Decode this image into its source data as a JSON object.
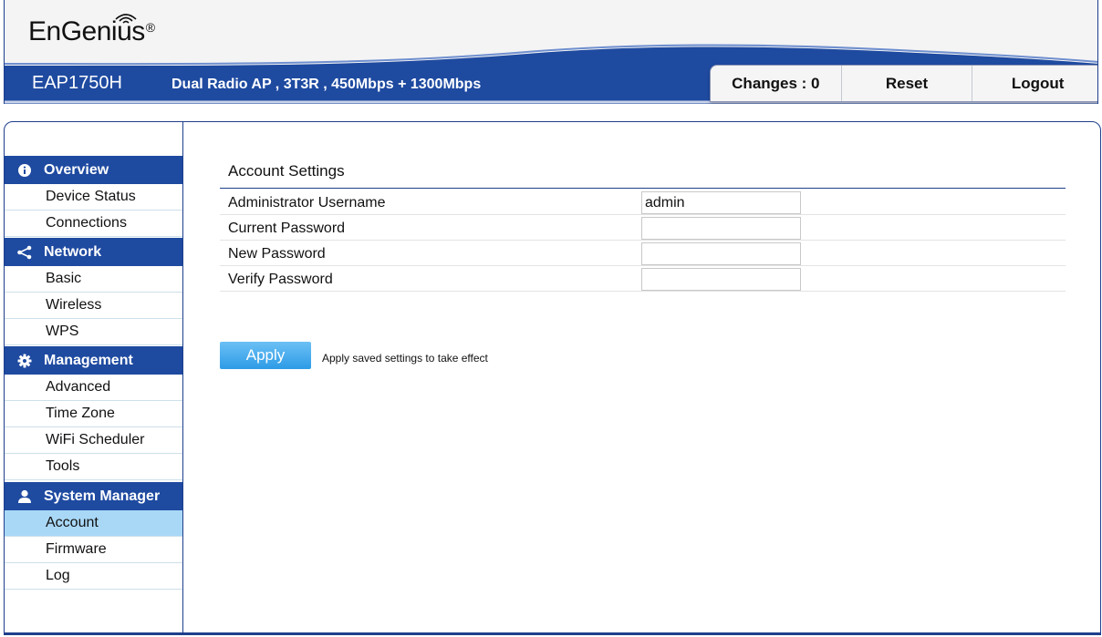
{
  "header": {
    "logo": "EnGenius",
    "logo_mark": "®",
    "model": "EAP1750H",
    "model_desc": "Dual Radio AP , 3T3R , 450Mbps + 1300Mbps",
    "buttons": {
      "changes": "Changes : 0",
      "reset": "Reset",
      "logout": "Logout"
    }
  },
  "sidebar": {
    "groups": [
      {
        "title": "Overview",
        "icon": "info-icon",
        "items": [
          "Device Status",
          "Connections"
        ]
      },
      {
        "title": "Network",
        "icon": "share-icon",
        "items": [
          "Basic",
          "Wireless",
          "WPS"
        ]
      },
      {
        "title": "Management",
        "icon": "gear-icon",
        "items": [
          "Advanced",
          "Time Zone",
          "WiFi Scheduler",
          "Tools"
        ]
      },
      {
        "title": "System Manager",
        "icon": "user-icon",
        "items": [
          "Account",
          "Firmware",
          "Log"
        ]
      }
    ],
    "active_item": "Account"
  },
  "content": {
    "title": "Account Settings",
    "fields": [
      {
        "label": "Administrator Username",
        "value": "admin"
      },
      {
        "label": "Current Password",
        "value": ""
      },
      {
        "label": "New Password",
        "value": ""
      },
      {
        "label": "Verify Password",
        "value": ""
      }
    ],
    "apply_label": "Apply",
    "apply_note": "Apply saved settings to take effect"
  },
  "colors": {
    "brand_blue": "#1e4aa0",
    "active_item": "#a9d8f7",
    "apply_button": "#3aa6ec"
  }
}
